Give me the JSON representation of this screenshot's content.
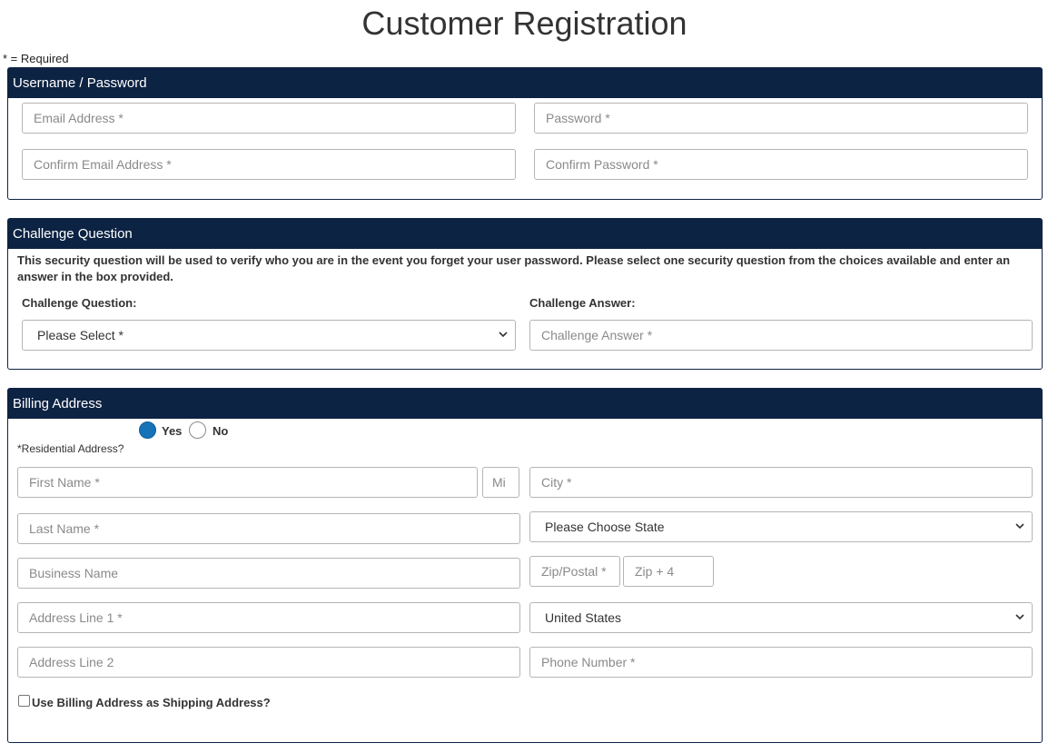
{
  "page": {
    "title": "Customer Registration",
    "required_note": "* = Required"
  },
  "credentials": {
    "header": "Username / Password",
    "email_placeholder": "Email Address *",
    "password_placeholder": "Password *",
    "confirm_email_placeholder": "Confirm Email Address *",
    "confirm_password_placeholder": "Confirm Password *"
  },
  "challenge": {
    "header": "Challenge Question",
    "description": "This security question will be used to verify who you are in the event you forget your user password. Please select one security question from the choices available and enter an answer in the box provided.",
    "question_label": "Challenge Question:",
    "answer_label": "Challenge Answer:",
    "question_selected": "Please Select *",
    "answer_placeholder": "Challenge Answer *"
  },
  "billing": {
    "header": "Billing Address",
    "residential_label": "*Residential Address?",
    "yes_label": "Yes",
    "no_label": "No",
    "residential_selected": "Yes",
    "first_name_placeholder": "First Name *",
    "mi_placeholder": "Mi",
    "city_placeholder": "City *",
    "last_name_placeholder": "Last Name *",
    "state_selected": "Please Choose State",
    "business_placeholder": "Business Name",
    "zip_placeholder": "Zip/Postal *",
    "zip4_placeholder": "Zip + 4",
    "address1_placeholder": "Address Line 1 *",
    "country_selected": "United States",
    "address2_placeholder": "Address Line 2",
    "phone_placeholder": "Phone Number *",
    "shipping_checkbox_label": "Use Billing Address as Shipping Address?",
    "shipping_checked": false
  },
  "colors": {
    "header_bg": "#0d2343",
    "radio_checked": "#1673b7"
  }
}
